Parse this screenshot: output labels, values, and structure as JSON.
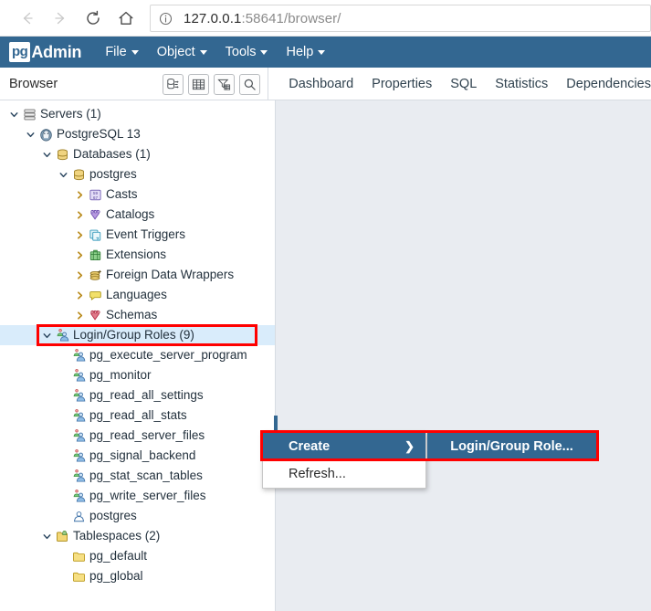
{
  "browser": {
    "nav": {
      "back": "back-arrow",
      "forward": "forward-arrow",
      "reload": "reload-icon",
      "home": "home-icon",
      "info": "info-icon"
    },
    "url_host": "127.0.0.1",
    "url_rest": ":58641/browser/",
    "url_full": "127.0.0.1:58641/browser/"
  },
  "app": {
    "logo_badge": "pg",
    "logo_text": "Admin",
    "brand_color": "#336791",
    "menus": [
      {
        "label": "File"
      },
      {
        "label": "Object"
      },
      {
        "label": "Tools"
      },
      {
        "label": "Help"
      }
    ]
  },
  "browser_pane": {
    "title": "Browser",
    "tools": [
      {
        "name": "object-explorer-icon",
        "glyph": "⚇"
      },
      {
        "name": "grid-icon",
        "glyph": "▦"
      },
      {
        "name": "filter-icon",
        "glyph": "▽"
      },
      {
        "name": "search-icon",
        "glyph": "⚲"
      }
    ]
  },
  "tabs": [
    {
      "label": "Dashboard"
    },
    {
      "label": "Properties"
    },
    {
      "label": "SQL"
    },
    {
      "label": "Statistics"
    },
    {
      "label": "Dependencies"
    }
  ],
  "tree": [
    {
      "label": "Servers (1)",
      "depth": 0,
      "twisty": "down",
      "icon": "servers-icon",
      "selected": false
    },
    {
      "label": "PostgreSQL 13",
      "depth": 1,
      "twisty": "down",
      "icon": "postgresql-icon",
      "selected": false
    },
    {
      "label": "Databases (1)",
      "depth": 2,
      "twisty": "down",
      "icon": "databases-icon",
      "selected": false
    },
    {
      "label": "postgres",
      "depth": 3,
      "twisty": "down",
      "icon": "database-icon",
      "selected": false
    },
    {
      "label": "Casts",
      "depth": 4,
      "twisty": "right",
      "icon": "casts-icon",
      "selected": false
    },
    {
      "label": "Catalogs",
      "depth": 4,
      "twisty": "right",
      "icon": "catalogs-icon",
      "selected": false
    },
    {
      "label": "Event Triggers",
      "depth": 4,
      "twisty": "right",
      "icon": "event-triggers-icon",
      "selected": false
    },
    {
      "label": "Extensions",
      "depth": 4,
      "twisty": "right",
      "icon": "extensions-icon",
      "selected": false
    },
    {
      "label": "Foreign Data Wrappers",
      "depth": 4,
      "twisty": "right",
      "icon": "foreign-data-wrappers-icon",
      "selected": false
    },
    {
      "label": "Languages",
      "depth": 4,
      "twisty": "right",
      "icon": "languages-icon",
      "selected": false
    },
    {
      "label": "Schemas",
      "depth": 4,
      "twisty": "right",
      "icon": "schemas-icon",
      "selected": false
    },
    {
      "label": "Login/Group Roles (9)",
      "depth": 2,
      "twisty": "down",
      "icon": "login-group-roles-icon",
      "selected": true
    },
    {
      "label": "pg_execute_server_program",
      "depth": 3,
      "twisty": "none",
      "icon": "group-role-icon",
      "selected": false
    },
    {
      "label": "pg_monitor",
      "depth": 3,
      "twisty": "none",
      "icon": "group-role-icon",
      "selected": false
    },
    {
      "label": "pg_read_all_settings",
      "depth": 3,
      "twisty": "none",
      "icon": "group-role-icon",
      "selected": false
    },
    {
      "label": "pg_read_all_stats",
      "depth": 3,
      "twisty": "none",
      "icon": "group-role-icon",
      "selected": false
    },
    {
      "label": "pg_read_server_files",
      "depth": 3,
      "twisty": "none",
      "icon": "group-role-icon",
      "selected": false
    },
    {
      "label": "pg_signal_backend",
      "depth": 3,
      "twisty": "none",
      "icon": "group-role-icon",
      "selected": false
    },
    {
      "label": "pg_stat_scan_tables",
      "depth": 3,
      "twisty": "none",
      "icon": "group-role-icon",
      "selected": false
    },
    {
      "label": "pg_write_server_files",
      "depth": 3,
      "twisty": "none",
      "icon": "group-role-icon",
      "selected": false
    },
    {
      "label": "postgres",
      "depth": 3,
      "twisty": "none",
      "icon": "login-role-icon",
      "selected": false
    },
    {
      "label": "Tablespaces (2)",
      "depth": 2,
      "twisty": "down",
      "icon": "tablespaces-icon",
      "selected": false
    },
    {
      "label": "pg_default",
      "depth": 3,
      "twisty": "none",
      "icon": "tablespace-icon",
      "selected": false
    },
    {
      "label": "pg_global",
      "depth": 3,
      "twisty": "none",
      "icon": "tablespace-icon",
      "selected": false
    }
  ],
  "context_menu": {
    "items": [
      {
        "label": "Create",
        "highlighted": true,
        "has_submenu": true,
        "arrow": "❯"
      },
      {
        "label": "Refresh...",
        "highlighted": false,
        "has_submenu": false,
        "arrow": ""
      }
    ],
    "submenu": {
      "items": [
        {
          "label": "Login/Group Role..."
        }
      ]
    },
    "highlight_color": "#336791",
    "annotation_color": "#ff0000"
  }
}
